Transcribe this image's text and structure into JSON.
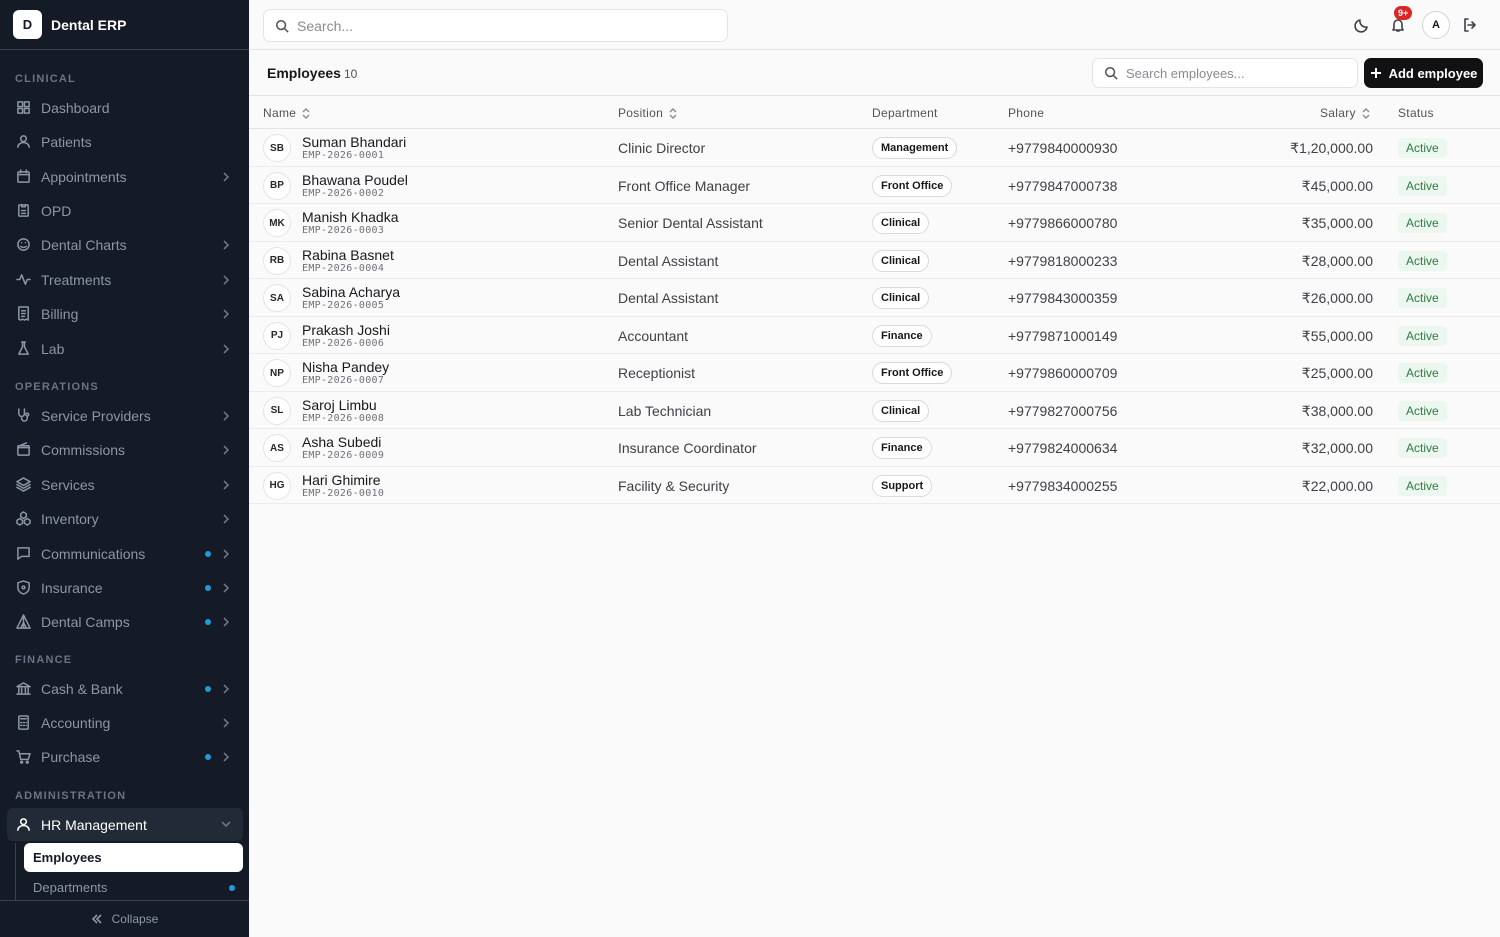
{
  "app": {
    "logo_letter": "D",
    "name": "Dental ERP"
  },
  "topbar": {
    "search_placeholder": "Search...",
    "notification_badge": "9+",
    "user_initial": "A"
  },
  "sidebar": {
    "sections": {
      "clinical": "CLINICAL",
      "operations": "OPERATIONS",
      "finance": "FINANCE",
      "administration": "ADMINISTRATION"
    },
    "items": {
      "dashboard": "Dashboard",
      "patients": "Patients",
      "appointments": "Appointments",
      "opd": "OPD",
      "dental_charts": "Dental Charts",
      "treatments": "Treatments",
      "billing": "Billing",
      "lab": "Lab",
      "service_providers": "Service Providers",
      "commissions": "Commissions",
      "services": "Services",
      "inventory": "Inventory",
      "communications": "Communications",
      "insurance": "Insurance",
      "dental_camps": "Dental Camps",
      "cash_bank": "Cash & Bank",
      "accounting": "Accounting",
      "purchase": "Purchase",
      "hr_management": "HR Management"
    },
    "sub_items": {
      "employees": "Employees",
      "departments": "Departments"
    },
    "collapse_label": "Collapse"
  },
  "page": {
    "title": "Employees",
    "count": "10",
    "search_placeholder": "Search employees...",
    "add_button": "Add employee"
  },
  "table": {
    "headers": {
      "name": "Name",
      "position": "Position",
      "department": "Department",
      "phone": "Phone",
      "salary": "Salary",
      "status": "Status"
    },
    "rows": [
      {
        "initials": "SB",
        "name": "Suman Bhandari",
        "code": "EMP-2026-0001",
        "position": "Clinic Director",
        "department": "Management",
        "phone": "+9779840000930",
        "salary": "₹1,20,000.00",
        "status": "Active"
      },
      {
        "initials": "BP",
        "name": "Bhawana Poudel",
        "code": "EMP-2026-0002",
        "position": "Front Office Manager",
        "department": "Front Office",
        "phone": "+9779847000738",
        "salary": "₹45,000.00",
        "status": "Active"
      },
      {
        "initials": "MK",
        "name": "Manish Khadka",
        "code": "EMP-2026-0003",
        "position": "Senior Dental Assistant",
        "department": "Clinical",
        "phone": "+9779866000780",
        "salary": "₹35,000.00",
        "status": "Active"
      },
      {
        "initials": "RB",
        "name": "Rabina Basnet",
        "code": "EMP-2026-0004",
        "position": "Dental Assistant",
        "department": "Clinical",
        "phone": "+9779818000233",
        "salary": "₹28,000.00",
        "status": "Active"
      },
      {
        "initials": "SA",
        "name": "Sabina Acharya",
        "code": "EMP-2026-0005",
        "position": "Dental Assistant",
        "department": "Clinical",
        "phone": "+9779843000359",
        "salary": "₹26,000.00",
        "status": "Active"
      },
      {
        "initials": "PJ",
        "name": "Prakash Joshi",
        "code": "EMP-2026-0006",
        "position": "Accountant",
        "department": "Finance",
        "phone": "+9779871000149",
        "salary": "₹55,000.00",
        "status": "Active"
      },
      {
        "initials": "NP",
        "name": "Nisha Pandey",
        "code": "EMP-2026-0007",
        "position": "Receptionist",
        "department": "Front Office",
        "phone": "+9779860000709",
        "salary": "₹25,000.00",
        "status": "Active"
      },
      {
        "initials": "SL",
        "name": "Saroj Limbu",
        "code": "EMP-2026-0008",
        "position": "Lab Technician",
        "department": "Clinical",
        "phone": "+9779827000756",
        "salary": "₹38,000.00",
        "status": "Active"
      },
      {
        "initials": "AS",
        "name": "Asha Subedi",
        "code": "EMP-2026-0009",
        "position": "Insurance Coordinator",
        "department": "Finance",
        "phone": "+9779824000634",
        "salary": "₹32,000.00",
        "status": "Active"
      },
      {
        "initials": "HG",
        "name": "Hari Ghimire",
        "code": "EMP-2026-0010",
        "position": "Facility & Security",
        "department": "Support",
        "phone": "+9779834000255",
        "salary": "₹22,000.00",
        "status": "Active"
      }
    ]
  },
  "colors": {
    "sidebar_bg": "#141a26",
    "accent_dot": "#1e9bd8",
    "status_green": "#2f7a43",
    "primary_button": "#111113",
    "badge_red": "#dc2626"
  }
}
